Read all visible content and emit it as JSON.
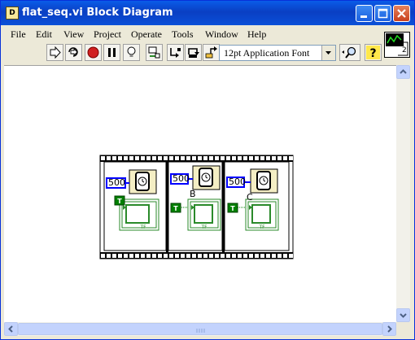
{
  "window": {
    "title": "flat_seq.vi Block Diagram"
  },
  "menu": [
    {
      "label": "File"
    },
    {
      "label": "Edit"
    },
    {
      "label": "View"
    },
    {
      "label": "Project"
    },
    {
      "label": "Operate"
    },
    {
      "label": "Tools"
    },
    {
      "label": "Window"
    },
    {
      "label": "Help"
    }
  ],
  "toolbar": {
    "font_select_value": "12pt Application Font"
  },
  "vi_icon": {
    "text": "2"
  },
  "diagram": {
    "frames": [
      {
        "constant": "500",
        "label": ""
      },
      {
        "constant": "500",
        "label": "B"
      },
      {
        "constant": "500",
        "label": "C"
      }
    ],
    "true_const": "T",
    "tf_label": "TF"
  },
  "colors": {
    "titlebar": "#0a3fc3",
    "wire_numeric": "#0000ff",
    "boolean": "#008000",
    "frame_border": "#000000"
  }
}
